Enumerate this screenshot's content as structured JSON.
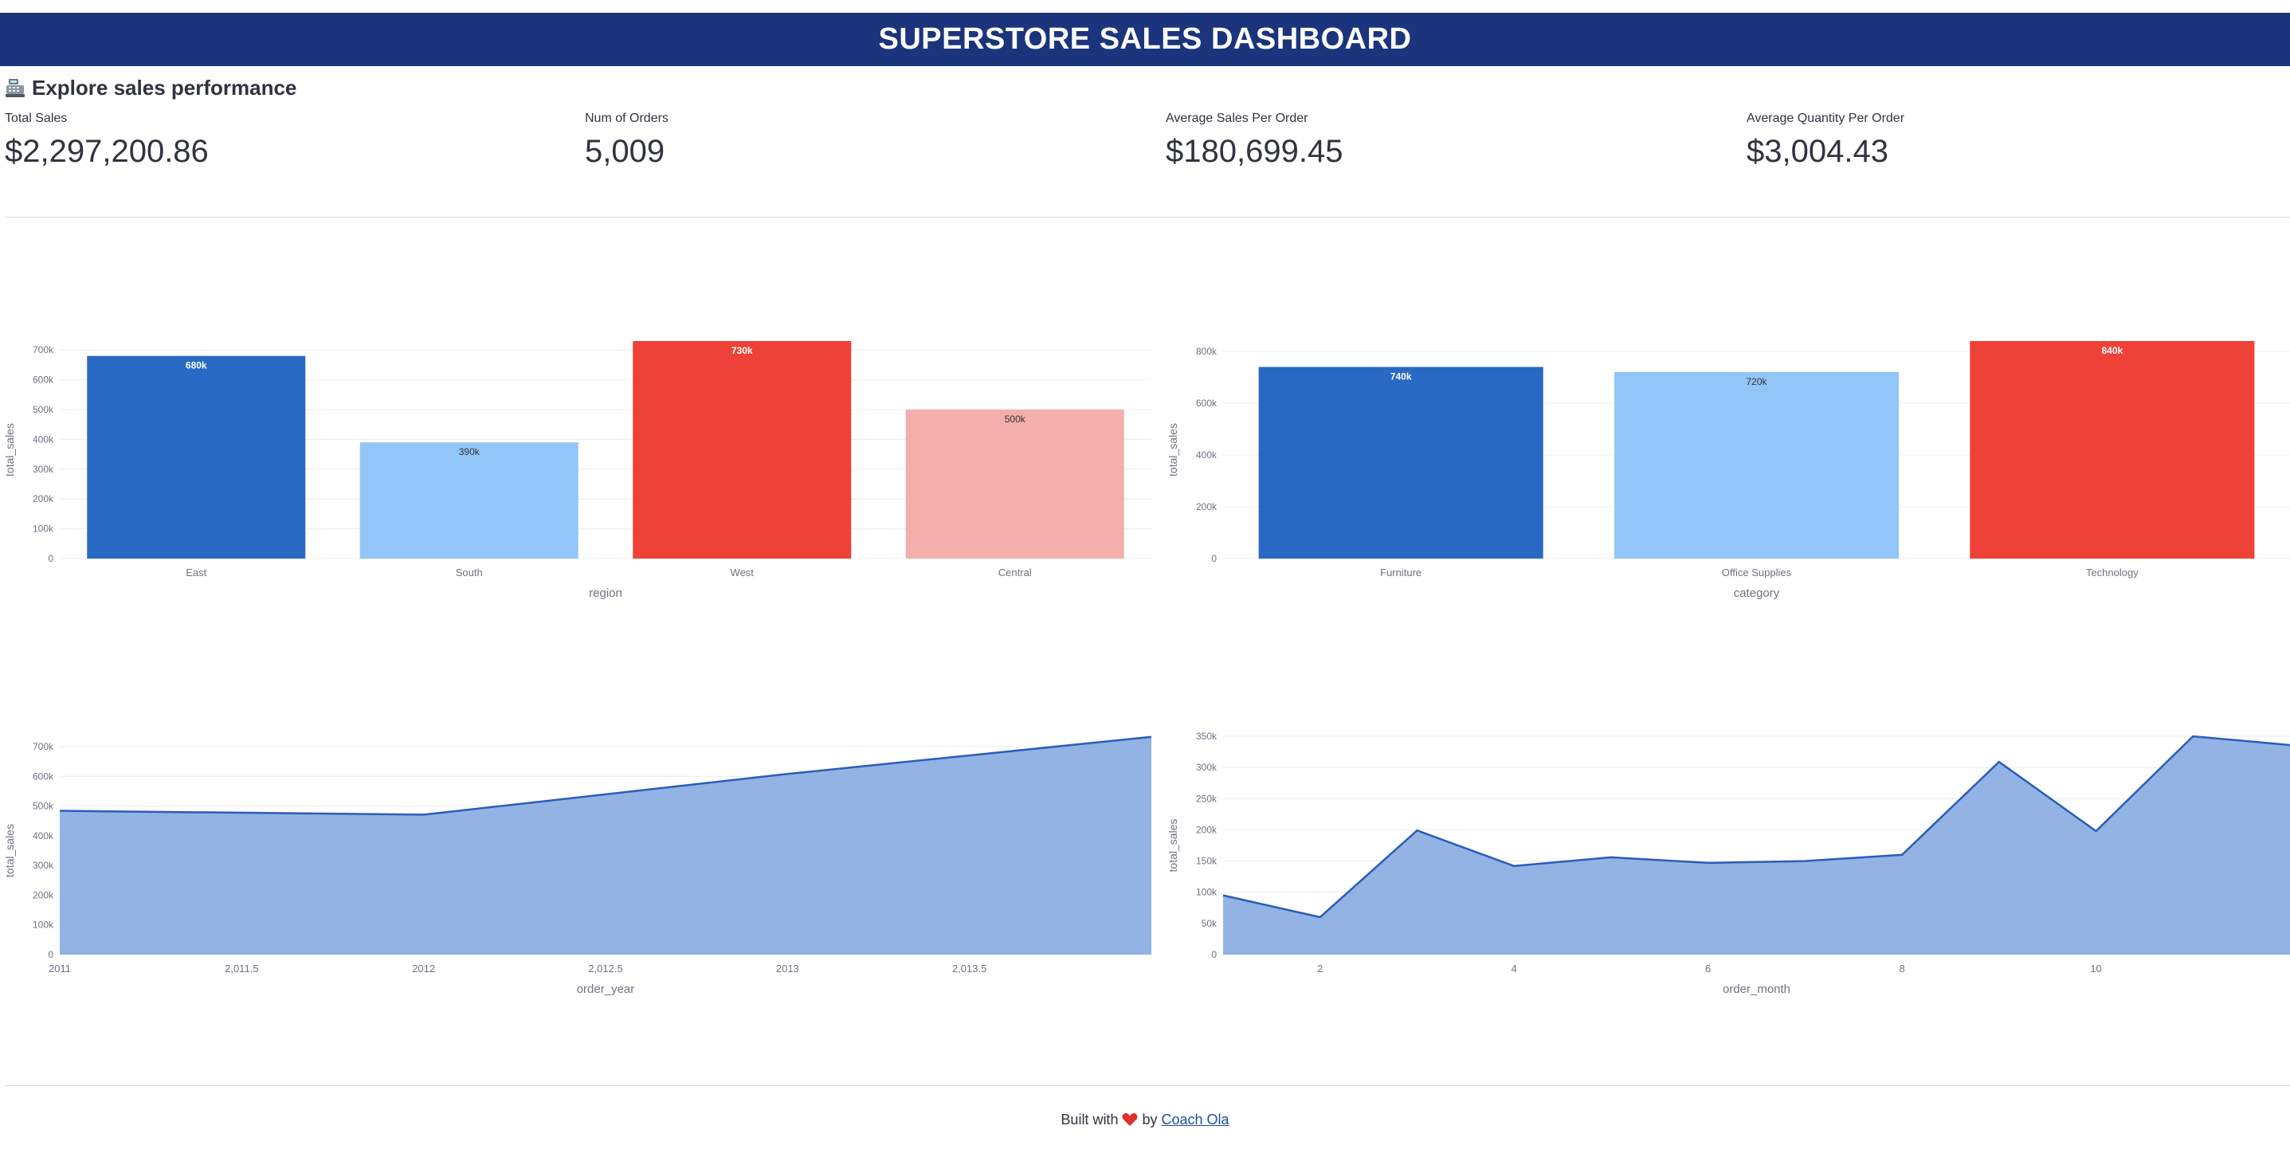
{
  "header": {
    "title": "SUPERSTORE SALES DASHBOARD"
  },
  "subheader": {
    "text": "Explore sales performance",
    "icon": "cash-register-icon"
  },
  "metrics": [
    {
      "label": "Total Sales",
      "value": "$2,297,200.86"
    },
    {
      "label": "Num of Orders",
      "value": "5,009"
    },
    {
      "label": "Average Sales Per Order",
      "value": "$180,699.45"
    },
    {
      "label": "Average Quantity Per Order",
      "value": "$3,004.43"
    }
  ],
  "footer": {
    "prefix": "Built with",
    "by": "by",
    "link_text": "Coach Ola",
    "icon": "heart-icon"
  },
  "colors": {
    "banner": "#1b347b",
    "dark_blue": "#2869c4",
    "light_blue": "#92c6f8",
    "red": "#ee4137",
    "pink": "#f4aeab",
    "area_fill": "#92b3e3",
    "area_line": "#2a5db8"
  },
  "chart_data": [
    {
      "type": "bar",
      "categories": [
        "East",
        "South",
        "West",
        "Central"
      ],
      "values": [
        680000,
        390000,
        730000,
        500000
      ],
      "data_labels": [
        "680k",
        "390k",
        "730k",
        "500k"
      ],
      "colors": [
        "#2869c4",
        "#92c6f8",
        "#ee4137",
        "#f4aeab"
      ],
      "xlabel": "region",
      "ylabel": "total_sales",
      "ylim": [
        0,
        730000
      ],
      "yticks": [
        0,
        100000,
        200000,
        300000,
        400000,
        500000,
        600000,
        700000
      ],
      "ytick_labels": [
        "0",
        "100k",
        "200k",
        "300k",
        "400k",
        "500k",
        "600k",
        "700k"
      ],
      "grid": true
    },
    {
      "type": "bar",
      "categories": [
        "Furniture",
        "Office Supplies",
        "Technology"
      ],
      "values": [
        740000,
        720000,
        840000
      ],
      "data_labels": [
        "740k",
        "720k",
        "840k"
      ],
      "colors": [
        "#2869c4",
        "#92c6f8",
        "#ee4137"
      ],
      "xlabel": "category",
      "ylabel": "total_sales",
      "ylim": [
        0,
        840000
      ],
      "yticks": [
        0,
        200000,
        400000,
        600000,
        800000
      ],
      "ytick_labels": [
        "0",
        "200k",
        "400k",
        "600k",
        "800k"
      ],
      "grid": true
    },
    {
      "type": "area",
      "x": [
        2011,
        2012,
        2013,
        2014
      ],
      "values": [
        484000,
        471000,
        608000,
        733000
      ],
      "xlabel": "order_year",
      "ylabel": "total_sales",
      "xlim": [
        2011,
        2014
      ],
      "ylim": [
        0,
        700000
      ],
      "xticks": [
        2011,
        2011.5,
        2012,
        2012.5,
        2013,
        2013.5
      ],
      "xtick_labels": [
        "2011",
        "2,011.5",
        "2012",
        "2,012.5",
        "2013",
        "2,013.5"
      ],
      "yticks": [
        0,
        100000,
        200000,
        300000,
        400000,
        500000,
        600000,
        700000
      ],
      "ytick_labels": [
        "0",
        "100k",
        "200k",
        "300k",
        "400k",
        "500k",
        "600k",
        "700k"
      ],
      "grid": true
    },
    {
      "type": "area",
      "x": [
        1,
        2,
        3,
        4,
        5,
        6,
        7,
        8,
        9,
        10,
        11,
        12
      ],
      "values": [
        95000,
        60000,
        199000,
        142000,
        156000,
        147000,
        150000,
        160000,
        309000,
        198000,
        350000,
        336000
      ],
      "xlabel": "order_month",
      "ylabel": "total_sales",
      "xlim": [
        1,
        12
      ],
      "ylim": [
        0,
        350000
      ],
      "xticks": [
        2,
        4,
        6,
        8,
        10
      ],
      "xtick_labels": [
        "2",
        "4",
        "6",
        "8",
        "10"
      ],
      "yticks": [
        0,
        50000,
        100000,
        150000,
        200000,
        250000,
        300000,
        350000
      ],
      "ytick_labels": [
        "0",
        "50k",
        "100k",
        "150k",
        "200k",
        "250k",
        "300k",
        "350k"
      ],
      "grid": true
    }
  ]
}
